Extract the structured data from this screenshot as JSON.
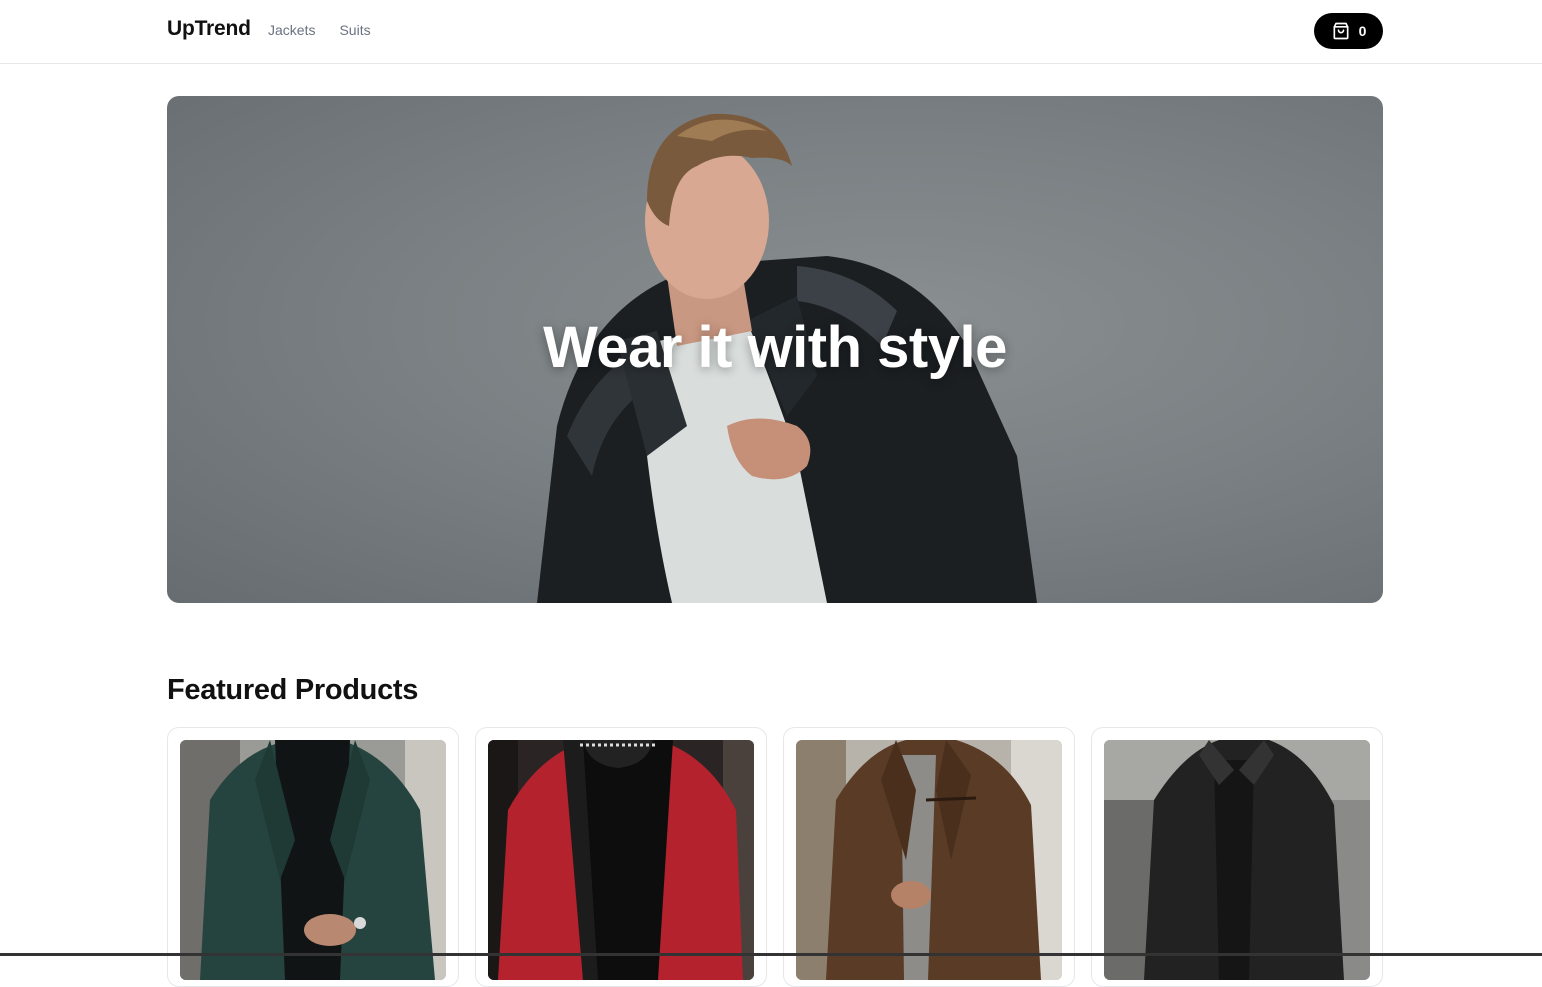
{
  "header": {
    "brand": "UpTrend",
    "nav": [
      {
        "label": "Jackets"
      },
      {
        "label": "Suits"
      }
    ],
    "cart": {
      "count": "0",
      "icon": "shopping-bag-icon"
    }
  },
  "hero": {
    "title": "Wear it with style",
    "image": "man-in-black-leather-jacket"
  },
  "featured": {
    "title": "Featured Products",
    "products": [
      {
        "image": "green-blazer",
        "accent": "#26443f"
      },
      {
        "image": "red-bomber-jacket",
        "accent": "#b3222d"
      },
      {
        "image": "brown-jacket",
        "accent": "#5a3b26"
      },
      {
        "image": "black-jacket",
        "accent": "#222222"
      }
    ]
  },
  "colors": {
    "cart_bg": "#000000",
    "hero_bg": "#7b8184",
    "text": "#111111",
    "nav_text": "#6b7280"
  }
}
